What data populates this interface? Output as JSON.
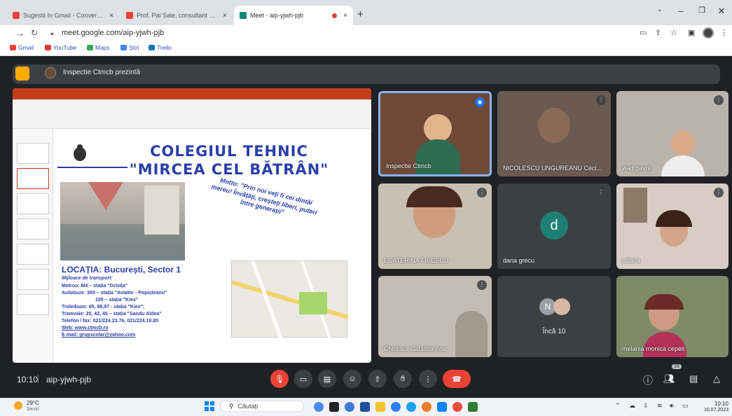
{
  "browser": {
    "tabs": [
      {
        "label": "Sugestii în Gmail - Conversație - Gmail",
        "active": false
      },
      {
        "label": "Prof. Pal Sale, consultant ME - Gmail",
        "active": false
      },
      {
        "label": "Meet - aip-yjwh-pjb",
        "active": true
      }
    ],
    "new_tab": "+",
    "url": "meet.google.com/aip-yjwh-pjb",
    "bookmarks": [
      "Gmail",
      "YouTube",
      "Maps",
      "Știri",
      "Trello"
    ]
  },
  "meet": {
    "presenter_label": "Inspectie Ctmcb prezintă",
    "time": "10:10",
    "meeting_code": "aip-yjwh-pjb",
    "more_count": "Încă 10",
    "people_badge": "16"
  },
  "slide": {
    "title_line1": "COLEGIUL TEHNIC",
    "title_line2": "\"MIRCEA CEL BĂTRÂN\"",
    "motto": "Motto: \"Prin noi veți fi cei dintâi mereu! Învățăți, creșteți liberi, puteri între generații\"",
    "location_heading": "LOCAȚIA: București, Sector 1",
    "transport_heading": "Mijloace de transport:",
    "lines": [
      "Metrou: M4 – stația \"Grivița\"",
      "Autobuze: 300 – stația \"Aviator - Popișteanu\"",
      "105 – stația \"Kiev\"",
      "Troleibuze: 65, 86,97 - stația \"Kiev\";",
      "Tramvaie: 20, 42, 45 – stația \"Sandu Aldea\"",
      "Telefon / fax: 021/224.23.76, 021/224.19.85",
      "Web: www.ctmcb.ro",
      "E-mail: grupscolar@yahoo.com"
    ]
  },
  "participants": [
    {
      "name": "Inspectie Ctmcb",
      "bg": "#6d4a37"
    },
    {
      "name": "NICOLESCU UNGUREANU Ceci...",
      "bg": "#6a5a50"
    },
    {
      "name": "vlad gavril",
      "bg": "#b9b3ab"
    },
    {
      "name": "ECATERINA FIRESCU",
      "bg": "#c9c0b4"
    },
    {
      "name": "dana grecu",
      "bg": "#3c4043",
      "initial": "d"
    },
    {
      "name": "Liliana",
      "bg": "#d8cdc2"
    },
    {
      "name": "Chiujdea Catalina Ana",
      "bg": "#c3bcb2"
    },
    {
      "name": "melania monica cepeii",
      "bg": "#7e8a68"
    }
  ],
  "taskbar": {
    "weather_temp": "29°C",
    "weather_desc": "Senin",
    "search_placeholder": "Căutați",
    "clock_time": "10:10",
    "clock_date": "10.07.2023"
  },
  "colors": {
    "meet_bg": "#202124",
    "end_call": "#ea4335",
    "ppt_red": "#c43e1c",
    "slide_blue": "#2b3fa8"
  }
}
